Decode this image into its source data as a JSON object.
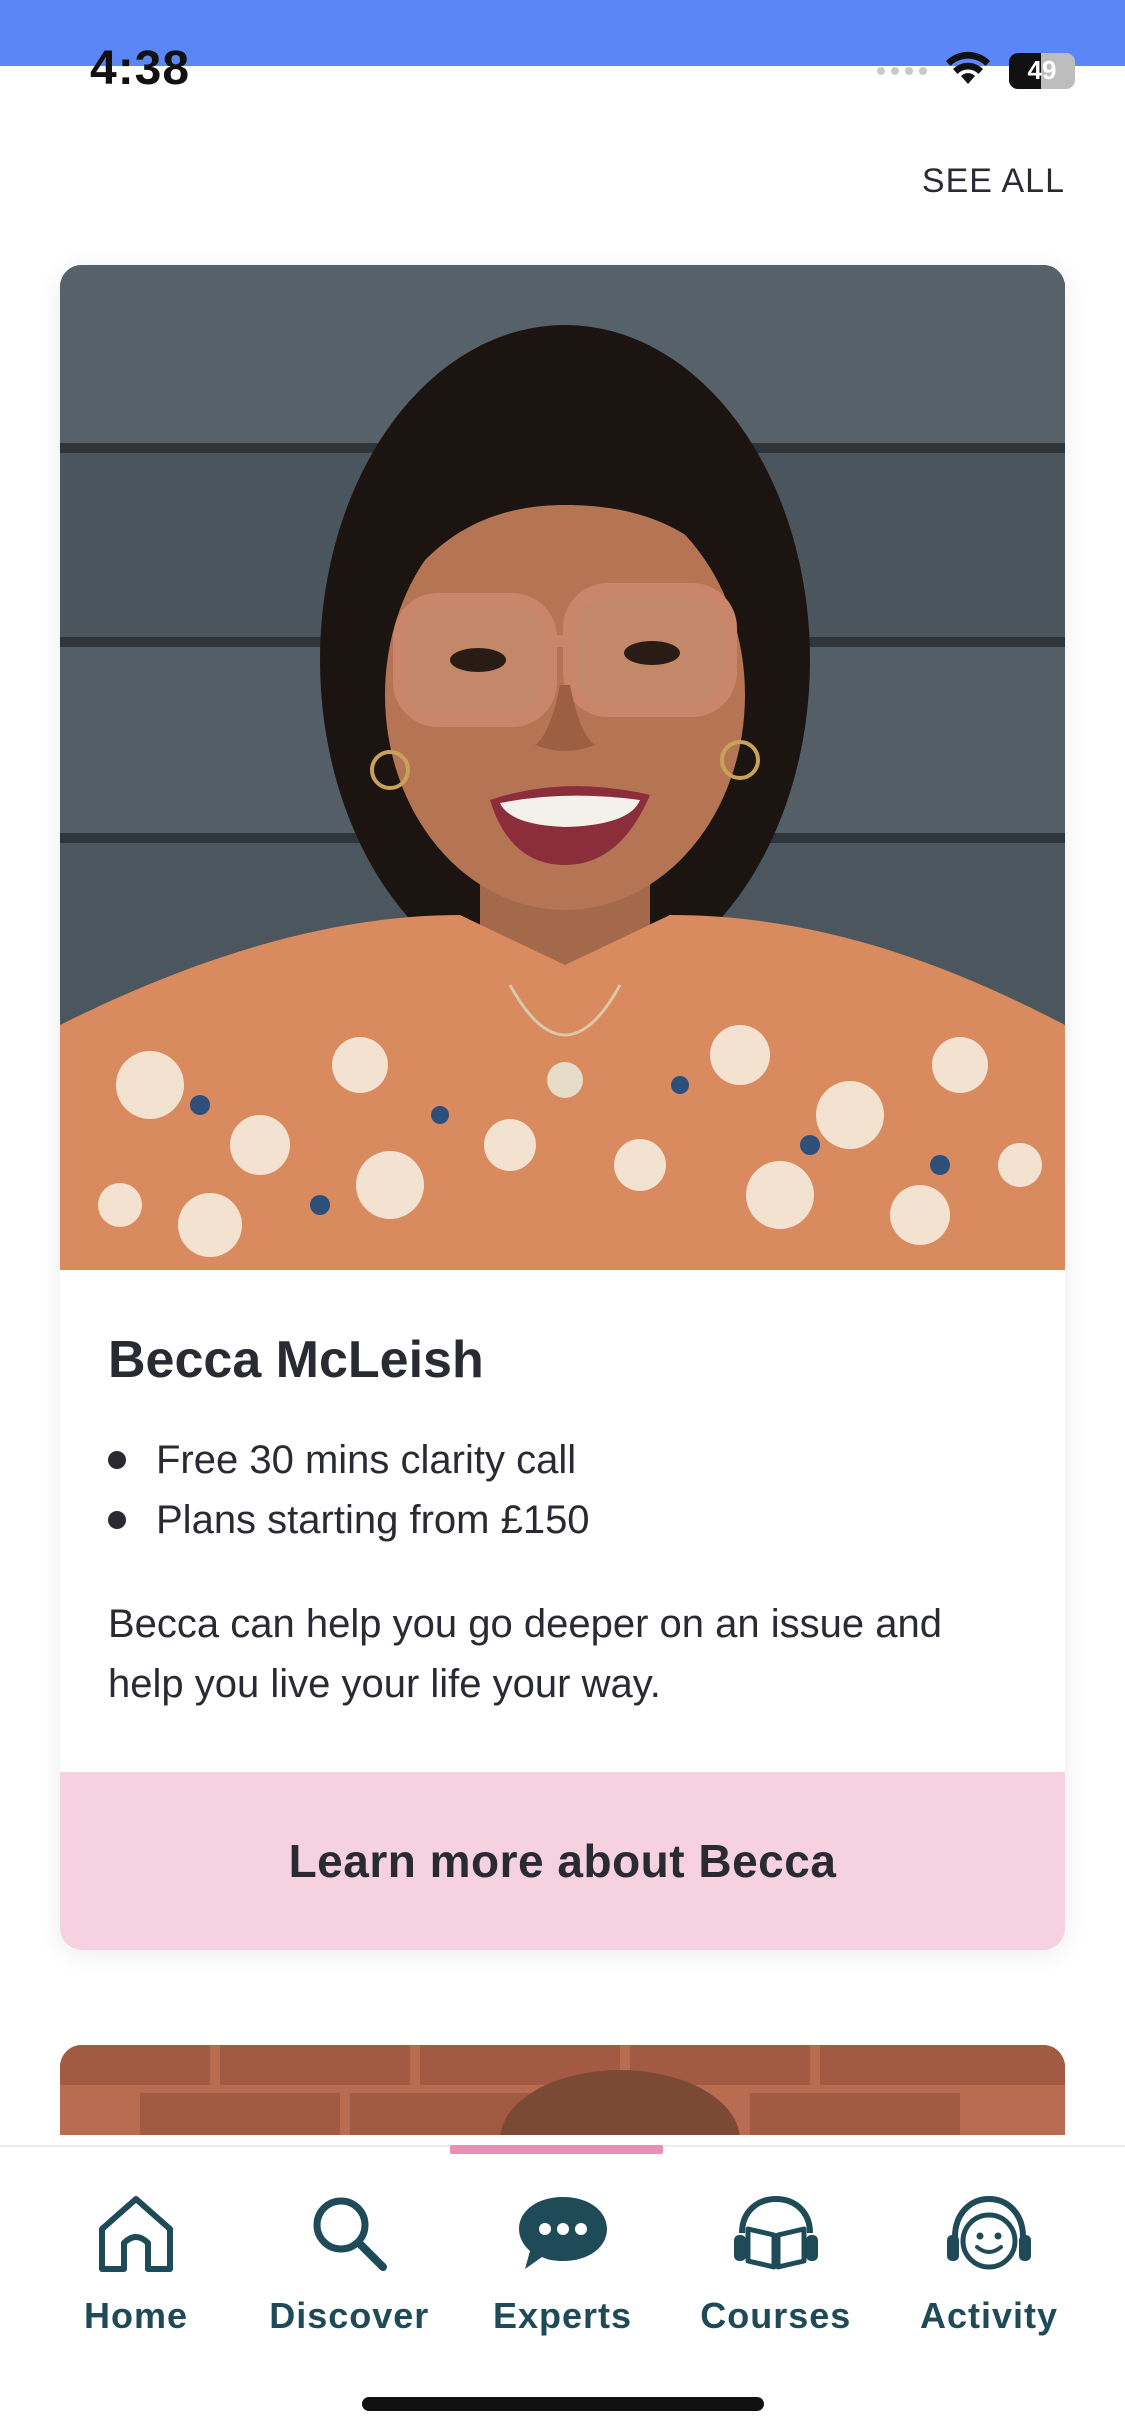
{
  "status_bar": {
    "time": "4:38",
    "battery_level": "49",
    "battery_fraction": 0.49,
    "band_color": "#5b86f7"
  },
  "section": {
    "see_all_label": "SEE ALL"
  },
  "expert_card": {
    "name": "Becca McLeish",
    "bullets": [
      "Free 30 mins clarity call",
      "Plans starting from £150"
    ],
    "description": "Becca can help you go deeper on an issue and help you live your life your way.",
    "cta_label": "Learn more about Becca",
    "cta_color": "#f6d1e0"
  },
  "tabbar": {
    "active_tab": "Experts",
    "accent_color": "#e88fb5",
    "label_color": "#1f4b58",
    "tabs": [
      {
        "label": "Home",
        "icon": "home-icon"
      },
      {
        "label": "Discover",
        "icon": "search-icon"
      },
      {
        "label": "Experts",
        "icon": "chat-bubble-icon"
      },
      {
        "label": "Courses",
        "icon": "open-book-icon"
      },
      {
        "label": "Activity",
        "icon": "headphones-smile-icon"
      }
    ]
  }
}
